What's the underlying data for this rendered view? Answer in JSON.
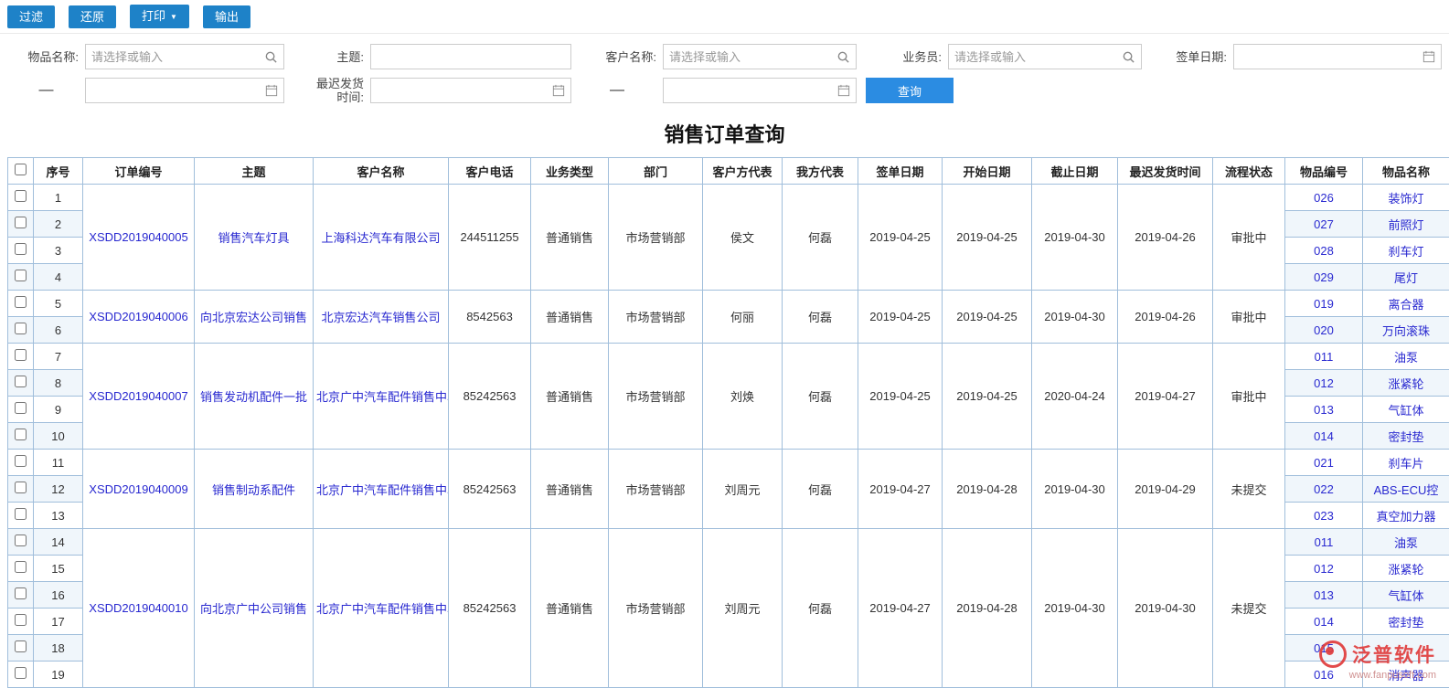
{
  "toolbar": {
    "buttons": [
      {
        "label": "过滤"
      },
      {
        "label": "还原"
      },
      {
        "label": "打印"
      },
      {
        "label": "输出"
      }
    ],
    "print_caret": "▼"
  },
  "filters": {
    "item_name_label": "物品名称:",
    "subject_label": "主题:",
    "customer_label": "客户名称:",
    "salesman_label": "业务员:",
    "sign_date_label": "签单日期:",
    "latest_ship_label": "最迟发货时间:",
    "placeholder": "请选择或输入",
    "range_dash": "—",
    "search_button": "查询"
  },
  "page_title": "销售订单查询",
  "table": {
    "headers": [
      "序号",
      "订单编号",
      "主题",
      "客户名称",
      "客户电话",
      "业务类型",
      "部门",
      "客户方代表",
      "我方代表",
      "签单日期",
      "开始日期",
      "截止日期",
      "最迟发货时间",
      "流程状态",
      "物品编号",
      "物品名称"
    ],
    "orders": [
      {
        "order_no": "XSDD2019040005",
        "subject": "销售汽车灯具",
        "customer": "上海科达汽车有限公司",
        "phone": "244511255",
        "biz_type": "普通销售",
        "dept": "市场营销部",
        "cust_rep": "侯文",
        "our_rep": "何磊",
        "sign_date": "2019-04-25",
        "start_date": "2019-04-25",
        "end_date": "2019-04-30",
        "latest_ship": "2019-04-26",
        "status": "审批中",
        "items": [
          {
            "no": "026",
            "name": "装饰灯"
          },
          {
            "no": "027",
            "name": "前照灯"
          },
          {
            "no": "028",
            "name": "刹车灯"
          },
          {
            "no": "029",
            "name": "尾灯"
          }
        ]
      },
      {
        "order_no": "XSDD2019040006",
        "subject": "向北京宏达公司销售",
        "customer": "北京宏达汽车销售公司",
        "phone": "8542563",
        "biz_type": "普通销售",
        "dept": "市场营销部",
        "cust_rep": "何丽",
        "our_rep": "何磊",
        "sign_date": "2019-04-25",
        "start_date": "2019-04-25",
        "end_date": "2019-04-30",
        "latest_ship": "2019-04-26",
        "status": "审批中",
        "items": [
          {
            "no": "019",
            "name": "离合器"
          },
          {
            "no": "020",
            "name": "万向滚珠"
          }
        ]
      },
      {
        "order_no": "XSDD2019040007",
        "subject": "销售发动机配件一批",
        "customer": "北京广中汽车配件销售中心",
        "phone": "85242563",
        "biz_type": "普通销售",
        "dept": "市场营销部",
        "cust_rep": "刘焕",
        "our_rep": "何磊",
        "sign_date": "2019-04-25",
        "start_date": "2019-04-25",
        "end_date": "2020-04-24",
        "latest_ship": "2019-04-27",
        "status": "审批中",
        "items": [
          {
            "no": "011",
            "name": "油泵"
          },
          {
            "no": "012",
            "name": "涨紧轮"
          },
          {
            "no": "013",
            "name": "气缸体"
          },
          {
            "no": "014",
            "name": "密封垫"
          }
        ]
      },
      {
        "order_no": "XSDD2019040009",
        "subject": "销售制动系配件",
        "customer": "北京广中汽车配件销售中心",
        "phone": "85242563",
        "biz_type": "普通销售",
        "dept": "市场营销部",
        "cust_rep": "刘周元",
        "our_rep": "何磊",
        "sign_date": "2019-04-27",
        "start_date": "2019-04-28",
        "end_date": "2019-04-30",
        "latest_ship": "2019-04-29",
        "status": "未提交",
        "items": [
          {
            "no": "021",
            "name": "刹车片"
          },
          {
            "no": "022",
            "name": "ABS-ECU控"
          },
          {
            "no": "023",
            "name": "真空加力器"
          }
        ]
      },
      {
        "order_no": "XSDD2019040010",
        "subject": "向北京广中公司销售",
        "customer": "北京广中汽车配件销售中心",
        "phone": "85242563",
        "biz_type": "普通销售",
        "dept": "市场营销部",
        "cust_rep": "刘周元",
        "our_rep": "何磊",
        "sign_date": "2019-04-27",
        "start_date": "2019-04-28",
        "end_date": "2019-04-30",
        "latest_ship": "2019-04-30",
        "status": "未提交",
        "items": [
          {
            "no": "011",
            "name": "油泵"
          },
          {
            "no": "012",
            "name": "涨紧轮"
          },
          {
            "no": "013",
            "name": "气缸体"
          },
          {
            "no": "014",
            "name": "密封垫"
          },
          {
            "no": "015",
            "name": ""
          },
          {
            "no": "016",
            "name": "消声器"
          }
        ]
      }
    ]
  },
  "watermark": {
    "brand": "泛普软件",
    "url": "www.fanpusoft.com"
  },
  "colors": {
    "toolbar_button": "#1e82c8",
    "query_button": "#2b8ce2",
    "link": "#2828d0",
    "table_border": "#a0bedb",
    "alt_row": "#f0f6fb",
    "watermark_red": "#e03c3c"
  }
}
